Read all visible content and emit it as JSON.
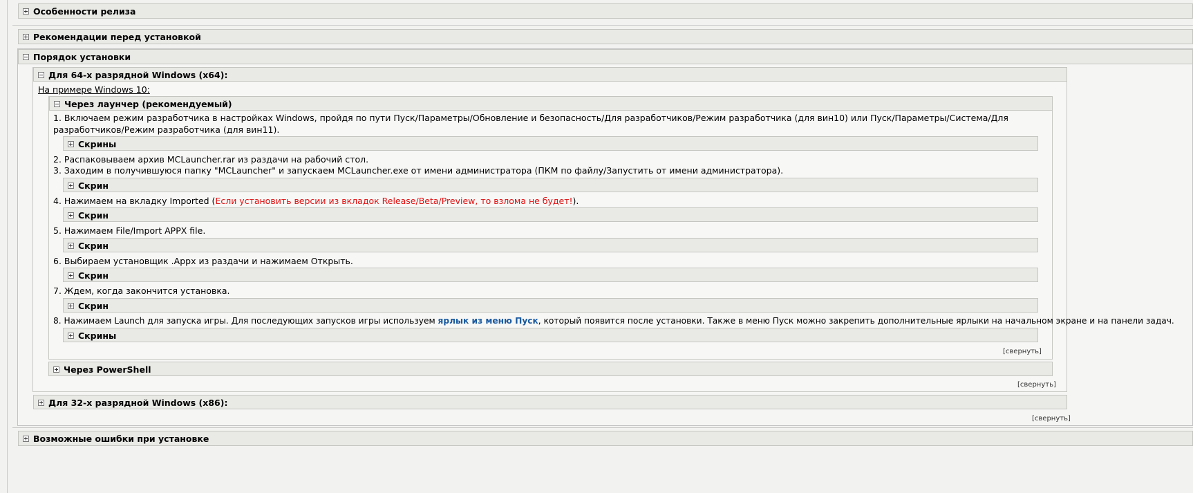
{
  "sections": {
    "features": "Особенности релиза",
    "recommendations": "Рекомендации перед установкой",
    "install_order": "Порядок установки",
    "errors": "Возможные ошибки при установке"
  },
  "x64": {
    "title": "Для 64-х разрядной Windows (x64):",
    "example": "На примере Windows 10:",
    "launcher": {
      "title": "Через лаунчер (рекомендуемый)",
      "step1": "1. Включаем режим разработчика в настройках Windows, пройдя по пути Пуск/Параметры/Обновление и безопасность/Для разработчиков/Режим разработчика (для вин10) или Пуск/Параметры/Система/Для разработчиков/Режим разработчика (для вин11).",
      "step2": "2. Распаковываем архив MCLauncher.rar из раздачи на рабочий стол.",
      "step3": "3. Заходим в получившуюся папку \"MCLauncher\" и запускаем MCLauncher.exe от имени администратора (ПКМ по файлу/Запустить от имени администратора).",
      "step4_a": "4. Нажимаем на вкладку Imported (",
      "step4_red": "Если установить версии из вкладок Release/Beta/Preview, то взлома не будет!",
      "step4_b": ").",
      "step5": "5. Нажимаем File/Import APPX file.",
      "step6": "6. Выбираем установщик .Appx из раздачи и нажимаем Открыть.",
      "step7": "7. Ждем, когда закончится установка.",
      "step8_a": "8. Нажимаем Launch для запуска игры. Для последующих запусков игры используем ",
      "step8_link": "ярлык из меню Пуск",
      "step8_b": ", который появится после установки. Также в меню Пуск можно закрепить дополнительные ярлыки на начальном экране и на панели задач.",
      "spoiler_screens": "Скрины",
      "spoiler_screen": "Скрин"
    },
    "powershell": "Через PowerShell"
  },
  "x86": {
    "title": "Для 32-х разрядной Windows (x86):"
  },
  "collapse": "[свернуть]"
}
